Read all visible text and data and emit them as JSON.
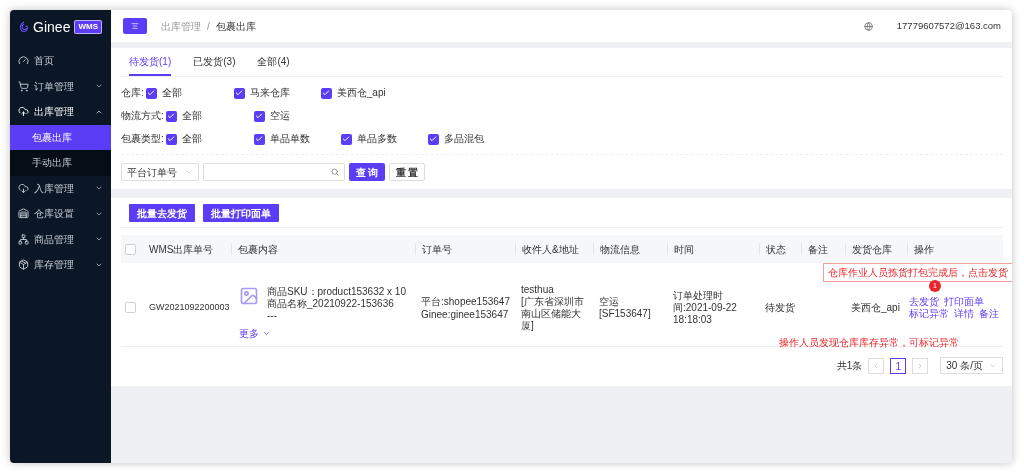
{
  "app": {
    "logo": "Ginee",
    "logo_badge": "WMS"
  },
  "sidebar": {
    "items": [
      {
        "kind": "link",
        "label": "首页",
        "selected": false
      },
      {
        "kind": "group",
        "label": "订单管理",
        "expanded": false
      },
      {
        "kind": "group",
        "label": "出库管理",
        "expanded": true,
        "children": [
          {
            "label": "包裹出库",
            "selected": true
          },
          {
            "label": "手动出库",
            "selected": false
          }
        ]
      },
      {
        "kind": "group",
        "label": "入库管理",
        "expanded": false
      },
      {
        "kind": "group",
        "label": "仓库设置",
        "expanded": false
      },
      {
        "kind": "group",
        "label": "商品管理",
        "expanded": false
      },
      {
        "kind": "group",
        "label": "库存管理",
        "expanded": false
      }
    ]
  },
  "header": {
    "breadcrumb": [
      "出库管理",
      "包裹出库"
    ],
    "breadcrumb_separator": "/",
    "user": "17779607572@163.com"
  },
  "tabs": [
    {
      "label": "待发货(1)",
      "selected": true
    },
    {
      "label": "已发货(3)",
      "selected": false
    },
    {
      "label": "全部(4)",
      "selected": false
    }
  ],
  "filters": [
    {
      "label": "仓库:",
      "options": [
        {
          "label": "全部",
          "checked": true
        },
        {
          "label": "马来仓库",
          "checked": true
        },
        {
          "label": "美西仓_api",
          "checked": true
        }
      ]
    },
    {
      "label": "物流方式:",
      "options": [
        {
          "label": "全部",
          "checked": true
        },
        {
          "label": "空运",
          "checked": true
        }
      ]
    },
    {
      "label": "包裹类型:",
      "options": [
        {
          "label": "全部",
          "checked": true
        },
        {
          "label": "单品单数",
          "checked": true
        },
        {
          "label": "单品多数",
          "checked": true
        },
        {
          "label": "多品混包",
          "checked": true
        }
      ]
    }
  ],
  "search": {
    "select": "平台订单号",
    "buttons": [
      {
        "label": "查 询",
        "kind": "primary"
      },
      {
        "label": "重 置",
        "kind": "default"
      }
    ]
  },
  "bulk_actions": [
    "批量去发货",
    "批量打印面单"
  ],
  "table": {
    "select_all_checked": false,
    "columns": [
      "WMS出库单号",
      "包裹内容",
      "订单号",
      "收件人&地址",
      "物流信息",
      "时间",
      "状态",
      "备注",
      "发货仓库",
      "操作"
    ],
    "rows": [
      {
        "checked": false,
        "wms_no": "GW2021092200003",
        "content": {
          "sku": "商品SKU：product153632 x 10",
          "name": "商品名称_20210922-153636",
          "extra": "---",
          "more": "更多"
        },
        "order_no": [
          "平台:shopee153647",
          "Ginee:ginee153647"
        ],
        "recipient": [
          "testhua",
          "[广东省深圳市南山区储能大厦]"
        ],
        "logistics": [
          "空运",
          "[SF153647]"
        ],
        "time": "订单处理时间:2021-09-22 18:18:03",
        "status": "待发货",
        "warehouse": "美西仓_api",
        "actions": [
          "去发货",
          "打印面单",
          "标记异常",
          "详情",
          "备注"
        ]
      }
    ]
  },
  "pagination": {
    "total": "共1条",
    "pages": [
      {
        "label": "1",
        "selected": true
      }
    ],
    "page_size": "30 条/页"
  },
  "annotations": [
    {
      "kind": "callout",
      "text": "仓库作业人员拣货打包完成后，点击发货"
    },
    {
      "kind": "badge",
      "text": "1"
    },
    {
      "kind": "note",
      "text": "操作人员发现仓库库存异常，可标记异常"
    }
  ]
}
